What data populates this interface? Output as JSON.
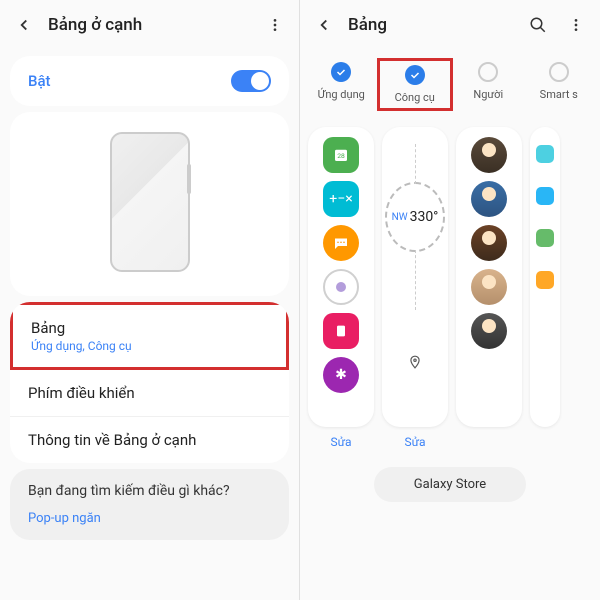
{
  "left": {
    "header": {
      "title": "Bảng ở cạnh"
    },
    "toggle": {
      "label": "Bật",
      "on": true
    },
    "menu": {
      "panel": {
        "title": "Bảng",
        "subtitle": "Ứng dụng, Công cụ"
      },
      "handler": {
        "title": "Phím điều khiển"
      },
      "about": {
        "title": "Thông tin về Bảng ở cạnh"
      }
    },
    "suggest": {
      "question": "Bạn đang tìm kiếm điều gì khác?",
      "link": "Pop-up ngăn"
    }
  },
  "right": {
    "header": {
      "title": "Bảng"
    },
    "tabs": {
      "apps": {
        "label": "Ứng dụng",
        "checked": true
      },
      "tools": {
        "label": "Công cụ",
        "checked": true
      },
      "people": {
        "label": "Người",
        "checked": false
      },
      "smart": {
        "label": "Smart s",
        "checked": false
      }
    },
    "compass": {
      "dir": "NW",
      "deg": "330°"
    },
    "edit": "Sửa",
    "store": "Galaxy Store"
  }
}
